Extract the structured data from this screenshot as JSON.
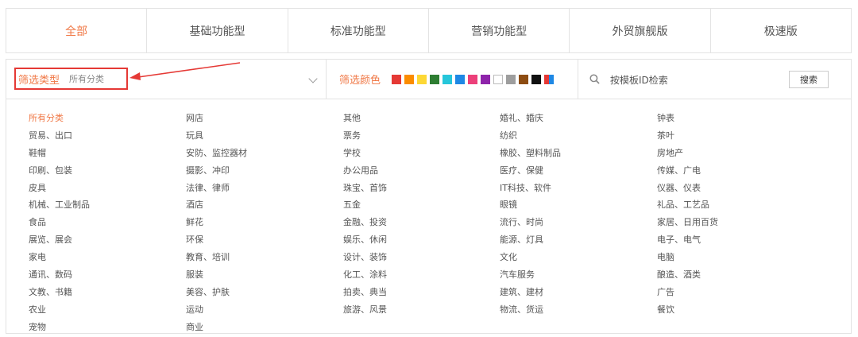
{
  "tabs": [
    "全部",
    "基础功能型",
    "标准功能型",
    "营销功能型",
    "外贸旗舰版",
    "极速版"
  ],
  "filter": {
    "type_label": "筛选类型",
    "type_value": "所有分类",
    "color_label": "筛选颜色",
    "colors": [
      "#e53935",
      "#fb8c00",
      "#fdd835",
      "#2e7d32",
      "#26c6da",
      "#1e88e5",
      "#ec407a",
      "#8e24aa",
      "#ffffff",
      "#9e9e9e",
      "#8d4c12",
      "#111111",
      "multi"
    ],
    "search_placeholder": "按模板ID检索",
    "search_button": "搜索"
  },
  "categories": [
    [
      "所有分类",
      "贸易、出口",
      "鞋帽",
      "印刷、包装",
      "皮具",
      "机械、工业制品",
      "食品",
      "展览、展会",
      "家电",
      "通讯、数码",
      "文教、书籍",
      "农业",
      "宠物"
    ],
    [
      "网店",
      "玩具",
      "安防、监控器材",
      "摄影、冲印",
      "法律、律师",
      "酒店",
      "鲜花",
      "环保",
      "教育、培训",
      "服装",
      "美容、护肤",
      "运动",
      "商业"
    ],
    [
      "其他",
      "票务",
      "学校",
      "办公用品",
      "珠宝、首饰",
      "五金",
      "金融、投资",
      "娱乐、休闲",
      "设计、装饰",
      "化工、涂料",
      "拍卖、典当",
      "旅游、风景"
    ],
    [
      "婚礼、婚庆",
      "纺织",
      "橡胶、塑料制品",
      "医疗、保健",
      "IT科技、软件",
      "眼镜",
      "流行、时尚",
      "能源、灯具",
      "文化",
      "汽车服务",
      "建筑、建材",
      "物流、货运"
    ],
    [
      "钟表",
      "茶叶",
      "房地产",
      "传媒、广电",
      "仪器、仪表",
      "礼品、工艺品",
      "家居、日用百货",
      "电子、电气",
      "电脑",
      "酿造、酒类",
      "广告",
      "餐饮"
    ]
  ]
}
